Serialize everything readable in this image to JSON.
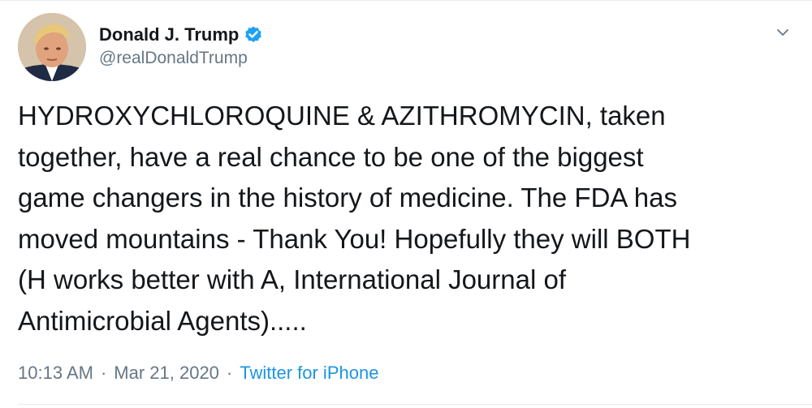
{
  "user": {
    "display_name": "Donald J. Trump",
    "handle": "@realDonaldTrump",
    "verified": true
  },
  "icons": {
    "verified": "verified-badge-icon",
    "caret": "chevron-down-icon",
    "avatar": "profile-photo"
  },
  "tweet": {
    "lines": [
      "HYDROXYCHLOROQUINE & AZITHROMYCIN, taken",
      "together, have a real chance to be one of the biggest",
      "game changers in the history of medicine. The FDA has",
      "moved mountains - Thank You! Hopefully they will BOTH",
      "(H works better with A, International Journal of",
      "Antimicrobial Agents)....."
    ]
  },
  "meta": {
    "time": "10:13 AM",
    "separator": "·",
    "date": "Mar 21, 2020",
    "source": "Twitter for iPhone"
  },
  "colors": {
    "text": "#14171a",
    "secondary": "#657786",
    "link": "#1b95e0",
    "verified": "#1da1f2",
    "divider": "#e6ecf0"
  }
}
